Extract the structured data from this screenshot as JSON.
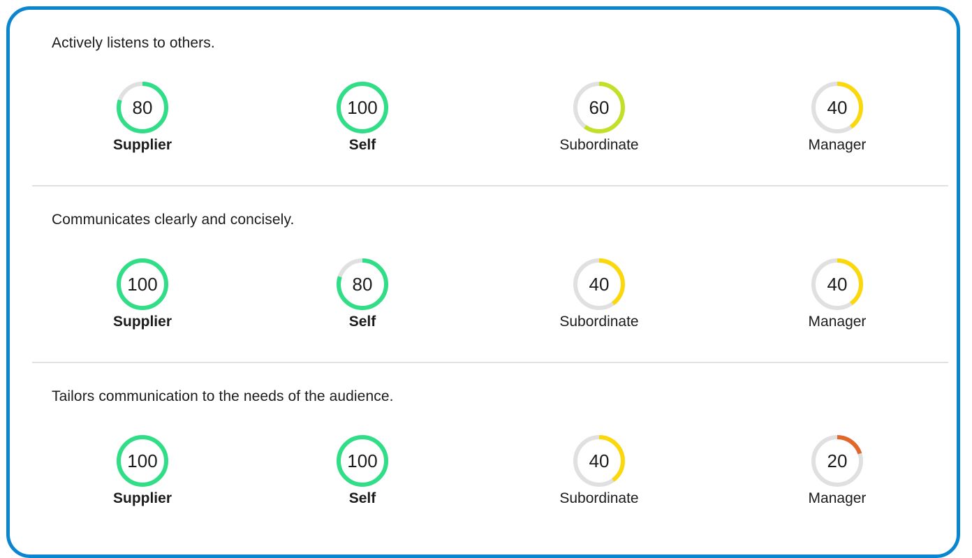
{
  "sections": [
    {
      "question": "Actively listens to others.",
      "ratings": [
        {
          "label": "Supplier",
          "value": "80",
          "percent": 80,
          "color": "#2fde86",
          "bold": true
        },
        {
          "label": "Self",
          "value": "100",
          "percent": 100,
          "color": "#2fde86",
          "bold": true
        },
        {
          "label": "Subordinate",
          "value": "60",
          "percent": 60,
          "color": "#c3e028",
          "bold": false
        },
        {
          "label": "Manager",
          "value": "40",
          "percent": 40,
          "color": "#fbd80c",
          "bold": false
        }
      ]
    },
    {
      "question": "Communicates clearly and concisely.",
      "ratings": [
        {
          "label": "Supplier",
          "value": "100",
          "percent": 100,
          "color": "#2fde86",
          "bold": true
        },
        {
          "label": "Self",
          "value": "80",
          "percent": 80,
          "color": "#2fde86",
          "bold": true
        },
        {
          "label": "Subordinate",
          "value": "40",
          "percent": 40,
          "color": "#fbd80c",
          "bold": false
        },
        {
          "label": "Manager",
          "value": "40",
          "percent": 40,
          "color": "#fbd80c",
          "bold": false
        }
      ]
    },
    {
      "question": "Tailors communication to the needs of the audience.",
      "ratings": [
        {
          "label": "Supplier",
          "value": "100",
          "percent": 100,
          "color": "#2fde86",
          "bold": true
        },
        {
          "label": "Self",
          "value": "100",
          "percent": 100,
          "color": "#2fde86",
          "bold": true
        },
        {
          "label": "Subordinate",
          "value": "40",
          "percent": 40,
          "color": "#fbd80c",
          "bold": false
        },
        {
          "label": "Manager",
          "value": "20",
          "percent": 20,
          "color": "#e2672a",
          "bold": false
        }
      ]
    }
  ],
  "colors": {
    "border": "#0a86d0",
    "track": "#e0e0e0",
    "divider": "#e1e1e1"
  }
}
